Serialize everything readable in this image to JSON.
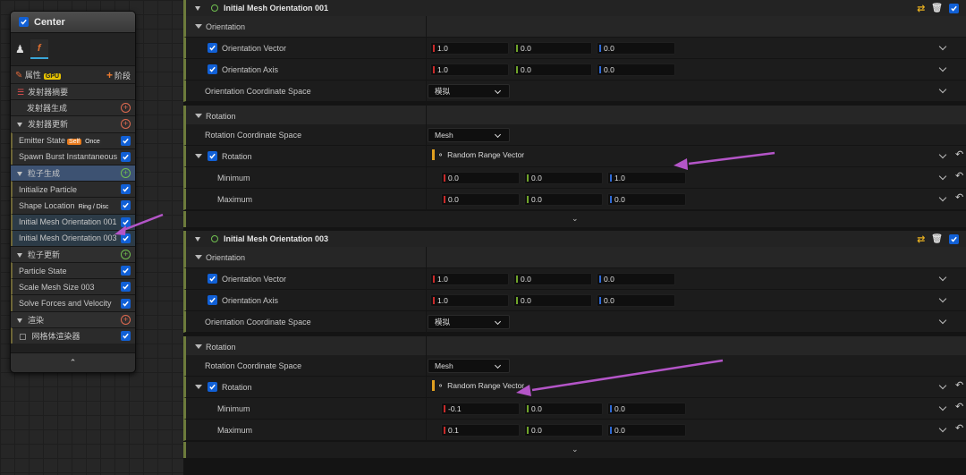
{
  "node": {
    "title": "Center",
    "props_label": "属性",
    "gpu_badge": "GPU",
    "stage_label": "阶段",
    "rows": [
      {
        "label": "发射器摘要",
        "kind": "sum"
      },
      {
        "label": "发射器生成",
        "kind": "sub"
      },
      {
        "label": "发射器更新",
        "kind": "sec"
      },
      {
        "label": "Emitter State",
        "kind": "mod",
        "badges": [
          "Self",
          "Once"
        ]
      },
      {
        "label": "Spawn Burst Instantaneous",
        "kind": "mod"
      },
      {
        "label": "粒子生成",
        "kind": "secblue"
      },
      {
        "label": "Initialize Particle",
        "kind": "mod"
      },
      {
        "label": "Shape Location",
        "kind": "mod",
        "badges": [
          "Ring / Disc"
        ]
      },
      {
        "label": "Initial Mesh Orientation 001",
        "kind": "mod"
      },
      {
        "label": "Initial Mesh Orientation 003",
        "kind": "mod"
      },
      {
        "label": "粒子更新",
        "kind": "secg"
      },
      {
        "label": "Particle State",
        "kind": "mod"
      },
      {
        "label": "Scale Mesh Size 003",
        "kind": "mod"
      },
      {
        "label": "Solve Forces and Velocity",
        "kind": "mod"
      },
      {
        "label": "渲染",
        "kind": "sec"
      },
      {
        "label": "网格体渲染器",
        "kind": "mod"
      }
    ]
  },
  "modules": [
    {
      "title": "Initial Mesh Orientation 001",
      "orientation_cat": "Orientation",
      "orientation_vector_label": "Orientation Vector",
      "orientation_vector": [
        "1.0",
        "0.0",
        "0.0"
      ],
      "orientation_axis_label": "Orientation Axis",
      "orientation_axis": [
        "1.0",
        "0.0",
        "0.0"
      ],
      "coord_space_label": "Orientation Coordinate Space",
      "coord_space_value": "模拟",
      "rotation_cat": "Rotation",
      "rot_coord_label": "Rotation Coordinate Space",
      "rot_coord_value": "Mesh",
      "rotation_label": "Rotation",
      "rotation_value": "Random Range Vector",
      "min_label": "Minimum",
      "minimum": [
        "0.0",
        "0.0",
        "1.0"
      ],
      "max_label": "Maximum",
      "maximum": [
        "0.0",
        "0.0",
        "0.0"
      ]
    },
    {
      "title": "Initial Mesh Orientation 003",
      "orientation_cat": "Orientation",
      "orientation_vector_label": "Orientation Vector",
      "orientation_vector": [
        "1.0",
        "0.0",
        "0.0"
      ],
      "orientation_axis_label": "Orientation Axis",
      "orientation_axis": [
        "1.0",
        "0.0",
        "0.0"
      ],
      "coord_space_label": "Orientation Coordinate Space",
      "coord_space_value": "模拟",
      "rotation_cat": "Rotation",
      "rot_coord_label": "Rotation Coordinate Space",
      "rot_coord_value": "Mesh",
      "rotation_label": "Rotation",
      "rotation_value": "Random Range Vector",
      "min_label": "Minimum",
      "minimum": [
        "-0.1",
        "0.0",
        "0.0"
      ],
      "max_label": "Maximum",
      "maximum": [
        "0.1",
        "0.0",
        "0.0"
      ]
    }
  ],
  "colors": {
    "accent_blue": "#1160d6",
    "annotation_arrow": "#b455c8",
    "shuffle_icon": "#e8b020"
  }
}
